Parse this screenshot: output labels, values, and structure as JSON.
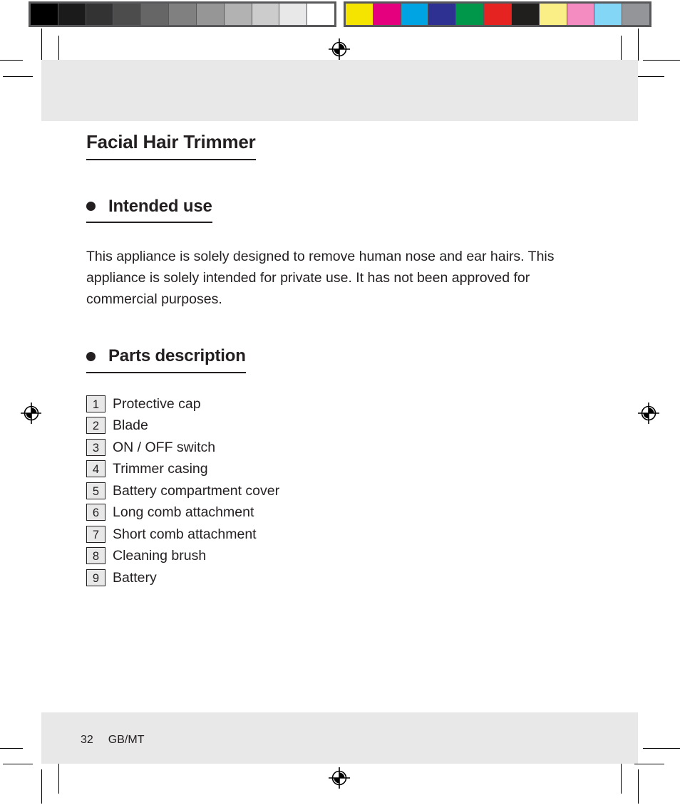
{
  "calibration": {
    "grayscale_label": "grayscale-step-wedge",
    "grayscale_swatches": [
      "#000000",
      "#1b1b1b",
      "#333333",
      "#4c4c4c",
      "#666666",
      "#808080",
      "#969696",
      "#b2b2b2",
      "#cccccc",
      "#e8e8e8",
      "#ffffff"
    ],
    "color_label": "color-control-patches",
    "color_swatches": [
      "#f5e400",
      "#e5007d",
      "#00a4e3",
      "#2e3192",
      "#00974b",
      "#e52421",
      "#211e1e",
      "#faee87",
      "#f48bc1",
      "#84d6f7",
      "#939598"
    ]
  },
  "marks": {
    "registration_top": "registration-target",
    "registration_bottom": "registration-target",
    "registration_left": "registration-target",
    "registration_right": "registration-target"
  },
  "document": {
    "title": "Facial Hair Trimmer"
  },
  "sections": [
    {
      "heading": "Intended use",
      "paragraphs": [
        "This appliance is solely designed to remove human nose and ear hairs. This appliance is solely intended for private use. It has not been approved for commercial purposes."
      ]
    },
    {
      "heading": "Parts description"
    }
  ],
  "parts": [
    {
      "number": "1",
      "label": "Protective cap"
    },
    {
      "number": "2",
      "label": "Blade"
    },
    {
      "number": "3",
      "label": "ON / OFF switch"
    },
    {
      "number": "4",
      "label": "Trimmer casing"
    },
    {
      "number": "5",
      "label": "Battery compartment cover"
    },
    {
      "number": "6",
      "label": "Long comb attachment"
    },
    {
      "number": "7",
      "label": "Short comb attachment"
    },
    {
      "number": "8",
      "label": "Cleaning brush"
    },
    {
      "number": "9",
      "label": "Battery"
    }
  ],
  "footer": {
    "page_number": "32",
    "language_code": "GB/MT"
  }
}
